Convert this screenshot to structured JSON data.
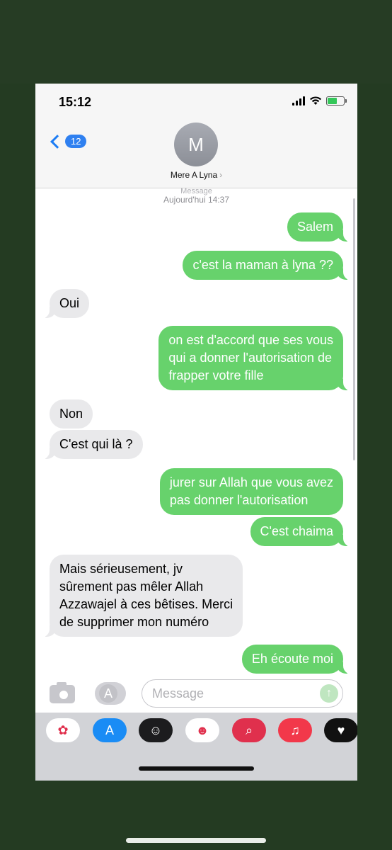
{
  "status": {
    "time": "15:12"
  },
  "header": {
    "back_count": "12",
    "avatar_initial": "M",
    "contact_name": "Mere A Lyna",
    "contact_chevron": "›"
  },
  "thread": {
    "meta_label": "Message",
    "date": "Aujourd'hui 14:37",
    "messages": [
      {
        "from": "me",
        "text": "Salem"
      },
      {
        "from": "me",
        "text": "c'est la maman à lyna ??"
      },
      {
        "from": "them",
        "text": "Oui"
      },
      {
        "from": "me",
        "text": "on est d'accord que ses vous\nqui a donner l'autorisation de\nfrapper votre fille"
      },
      {
        "from": "them",
        "text": "Non"
      },
      {
        "from": "them",
        "text": "C'est qui là ?"
      },
      {
        "from": "me",
        "text": "jurer sur Allah que vous avez\npas donner l'autorisation"
      },
      {
        "from": "me",
        "text": "C'est chaima"
      },
      {
        "from": "them",
        "text": "Mais sérieusement, jv\nsûrement pas mêler Allah\nAzzawajel à ces bêtises.  Merci\nde supprimer mon numéro"
      },
      {
        "from": "me",
        "text": "Eh écoute moi"
      }
    ]
  },
  "composer": {
    "placeholder": "Message",
    "send_glyph": "↑",
    "apps_glyph": "A"
  },
  "drawer": {
    "apps": [
      {
        "name": "photos-app",
        "glyph": "✿",
        "color": "#ffffff"
      },
      {
        "name": "app-store-app",
        "glyph": "A",
        "color": "#1a8cf5"
      },
      {
        "name": "memoji-app",
        "glyph": "☺",
        "color": "#1c1c1e"
      },
      {
        "name": "animoji-app",
        "glyph": "☻",
        "color": "#ffffff"
      },
      {
        "name": "search-images-app",
        "glyph": "⌕",
        "color": "#e0304d"
      },
      {
        "name": "music-app",
        "glyph": "♫",
        "color": "#f2384a"
      },
      {
        "name": "digital-touch-app",
        "glyph": "♥",
        "color": "#111111"
      }
    ]
  },
  "colors": {
    "sent_bubble": "#67d26c",
    "received_bubble": "#e9e9eb",
    "accent": "#1c7cf4"
  }
}
